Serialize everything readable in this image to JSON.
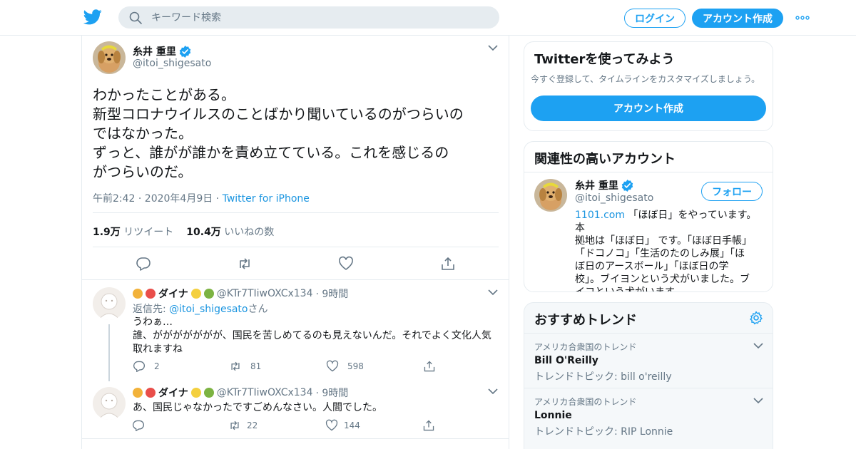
{
  "header": {
    "search_placeholder": "キーワード検索",
    "login_label": "ログイン",
    "signup_label": "アカウント作成"
  },
  "tweet": {
    "author_name": "糸井 重里",
    "author_handle": "@itoi_shigesato",
    "lines": [
      "わかったことがある。",
      "新型コロナウイルスのことばかり聞いているのがつらいの",
      "ではなかった。",
      "ずっと、誰がが誰かを責め立てている。これを感じるの",
      "がつらいのだ。"
    ],
    "timestamp": "午前2:42 · 2020年4月9日 · ",
    "source": "Twitter for iPhone",
    "retweet_count": "1.9万",
    "retweet_label": "リツイート",
    "like_count": "10.4万",
    "like_label": "いいねの数"
  },
  "replies": [
    {
      "name": "ダイナ",
      "handle": "@KTr7TIiwOXCx134",
      "time": "· 9時間",
      "reply_to_prefix": "返信先: ",
      "reply_to_handle": "@itoi_shigesato",
      "reply_to_suffix": "さん",
      "text_lines": [
        "うわぁ…",
        "誰、ががががががが、国民を苦しめてるのも見えないんだ。それでよく文化人気",
        "取れますね"
      ],
      "reply_count": "2",
      "retweet_count": "81",
      "like_count": "598"
    },
    {
      "name": "ダイナ",
      "handle": "@KTr7TIiwOXCx134",
      "time": "· 9時間",
      "text_lines": [
        "あ、国民じゃなかったですごめんなさい。人間でした。"
      ],
      "reply_count": "",
      "retweet_count": "22",
      "like_count": "144"
    }
  ],
  "sidebar": {
    "signup_card": {
      "title": "Twitterを使ってみよう",
      "subtitle": "今すぐ登録して、タイムラインをカスタマイズしましょう。",
      "button": "アカウント作成"
    },
    "related_card": {
      "title": "関連性の高いアカウント",
      "name": "糸井 重里",
      "handle": "@itoi_shigesato",
      "follow_label": "フォロー",
      "bio_link": "1101.com",
      "bio_lines": [
        " 「ほぼ日」をやっています。本",
        "拠地は「ほぼ日」 です。「ほぼ日手帳」",
        "「ドコノコ」「生活のたのしみ展」「ほ",
        "ぼ日のアースボール」「ほぼ日の学",
        "校」。ブイヨンという犬がいました。ブ",
        "イコという犬がいます。"
      ]
    },
    "trends_card": {
      "title": "おすすめトレンド",
      "trends": [
        {
          "context": "アメリカ合衆国のトレンド",
          "name": "Bill O'Reilly",
          "topic": "トレンドトピック: bill o'reilly"
        },
        {
          "context": "アメリカ合衆国のトレンド",
          "name": "Lonnie",
          "topic": "トレンドトピック: RIP Lonnie"
        }
      ]
    }
  },
  "colors": {
    "accent": "#1da1f2",
    "link": "#1b95e0",
    "muted": "#657786",
    "border": "#e6ecf0"
  }
}
